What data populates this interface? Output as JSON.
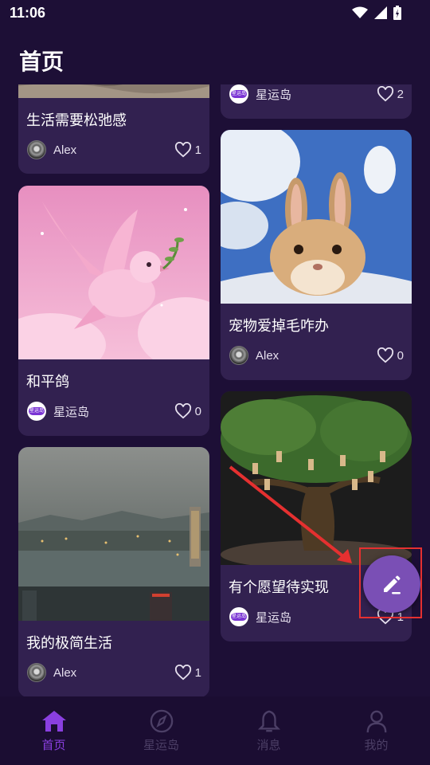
{
  "status_bar": {
    "time": "11:06"
  },
  "header": {
    "title": "首页"
  },
  "cards": [
    {
      "title": "生活需要松弛感",
      "author": "Alex",
      "likes": "1"
    },
    {
      "title": "",
      "author": "星运岛",
      "likes": "2"
    },
    {
      "title": "和平鸽",
      "author": "星运岛",
      "likes": "0"
    },
    {
      "title": "宠物爱掉毛咋办",
      "author": "Alex",
      "likes": "0"
    },
    {
      "title": "我的极简生活",
      "author": "Alex",
      "likes": "1"
    },
    {
      "title": "有个愿望待实现",
      "author": "星运岛",
      "likes": "1"
    }
  ],
  "avatar_logo_text": "星运岛",
  "bottom_nav": [
    {
      "label": "首页",
      "icon": "home-icon",
      "active": true
    },
    {
      "label": "星运岛",
      "icon": "compass-icon",
      "active": false
    },
    {
      "label": "消息",
      "icon": "bell-icon",
      "active": false
    },
    {
      "label": "我的",
      "icon": "person-icon",
      "active": false
    }
  ],
  "fab": {
    "icon": "edit-icon"
  },
  "colors": {
    "background": "#1d0f36",
    "card": "#322150",
    "accent": "#8a3fe0",
    "fab": "#7a4fb5",
    "annotation": "#e53030"
  }
}
